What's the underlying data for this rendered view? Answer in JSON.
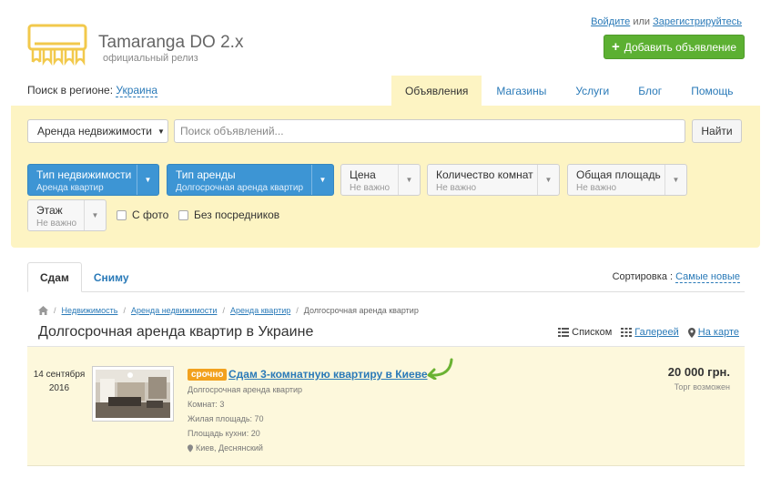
{
  "header": {
    "site_title": "Tamaranga DO 2.x",
    "site_subtitle": "официальный релиз",
    "login_label": "Войдите",
    "or_label": "или",
    "register_label": "Зарегистрируйтесь",
    "add_button_label": "Добавить объявление"
  },
  "region": {
    "label": "Поиск в регионе:",
    "value": "Украина"
  },
  "nav": [
    {
      "label": "Объявления",
      "active": true
    },
    {
      "label": "Магазины"
    },
    {
      "label": "Услуги"
    },
    {
      "label": "Блог"
    },
    {
      "label": "Помощь"
    }
  ],
  "search": {
    "category_label": "Аренда недвижимости",
    "placeholder": "Поиск объявлений...",
    "find_label": "Найти"
  },
  "filters": [
    {
      "title": "Тип недвижимости",
      "value": "Аренда квартир"
    },
    {
      "title": "Тип аренды",
      "value": "Долгосрочная аренда квартир"
    },
    {
      "title": "Цена",
      "value": "Не важно"
    },
    {
      "title": "Количество комнат",
      "value": "Не важно"
    },
    {
      "title": "Общая площадь",
      "value": "Не важно"
    },
    {
      "title": "Этаж",
      "value": "Не важно"
    }
  ],
  "checkboxes": [
    {
      "label": "С фото"
    },
    {
      "label": "Без посредников"
    }
  ],
  "tabs": [
    {
      "label": "Сдам",
      "active": true
    },
    {
      "label": "Сниму"
    }
  ],
  "sort": {
    "label": "Сортировка :",
    "value": "Самые новые"
  },
  "breadcrumbs": [
    "Недвижимость",
    "Аренда недвижимости",
    "Аренда квартир",
    "Долгосрочная аренда квартир"
  ],
  "page_title": "Долгосрочная аренда квартир в Украине",
  "views": {
    "list_label": "Списком",
    "gallery_label": "Галереей",
    "map_label": "На карте"
  },
  "listing": {
    "date_line1": "14 сентября",
    "date_line2": "2016",
    "badge": "срочно",
    "title": "Сдам 3-комнатную квартиру в Киеве",
    "category": "Долгосрочная аренда квартир",
    "rooms": "Комнат: 3",
    "living_area": "Жилая площадь: 70",
    "kitchen_area": "Площадь кухни: 20",
    "location": "Киев, Деснянский",
    "price": "20 000 грн.",
    "bargain": "Торг возможен"
  },
  "colors": {
    "accent_link": "#2a7ab8",
    "add_button": "#5cb032",
    "panel_bg": "#fdf4c3",
    "filter_active": "#3d95d4",
    "urgent_badge": "#f2a11e",
    "logo": "#f2c94c"
  }
}
